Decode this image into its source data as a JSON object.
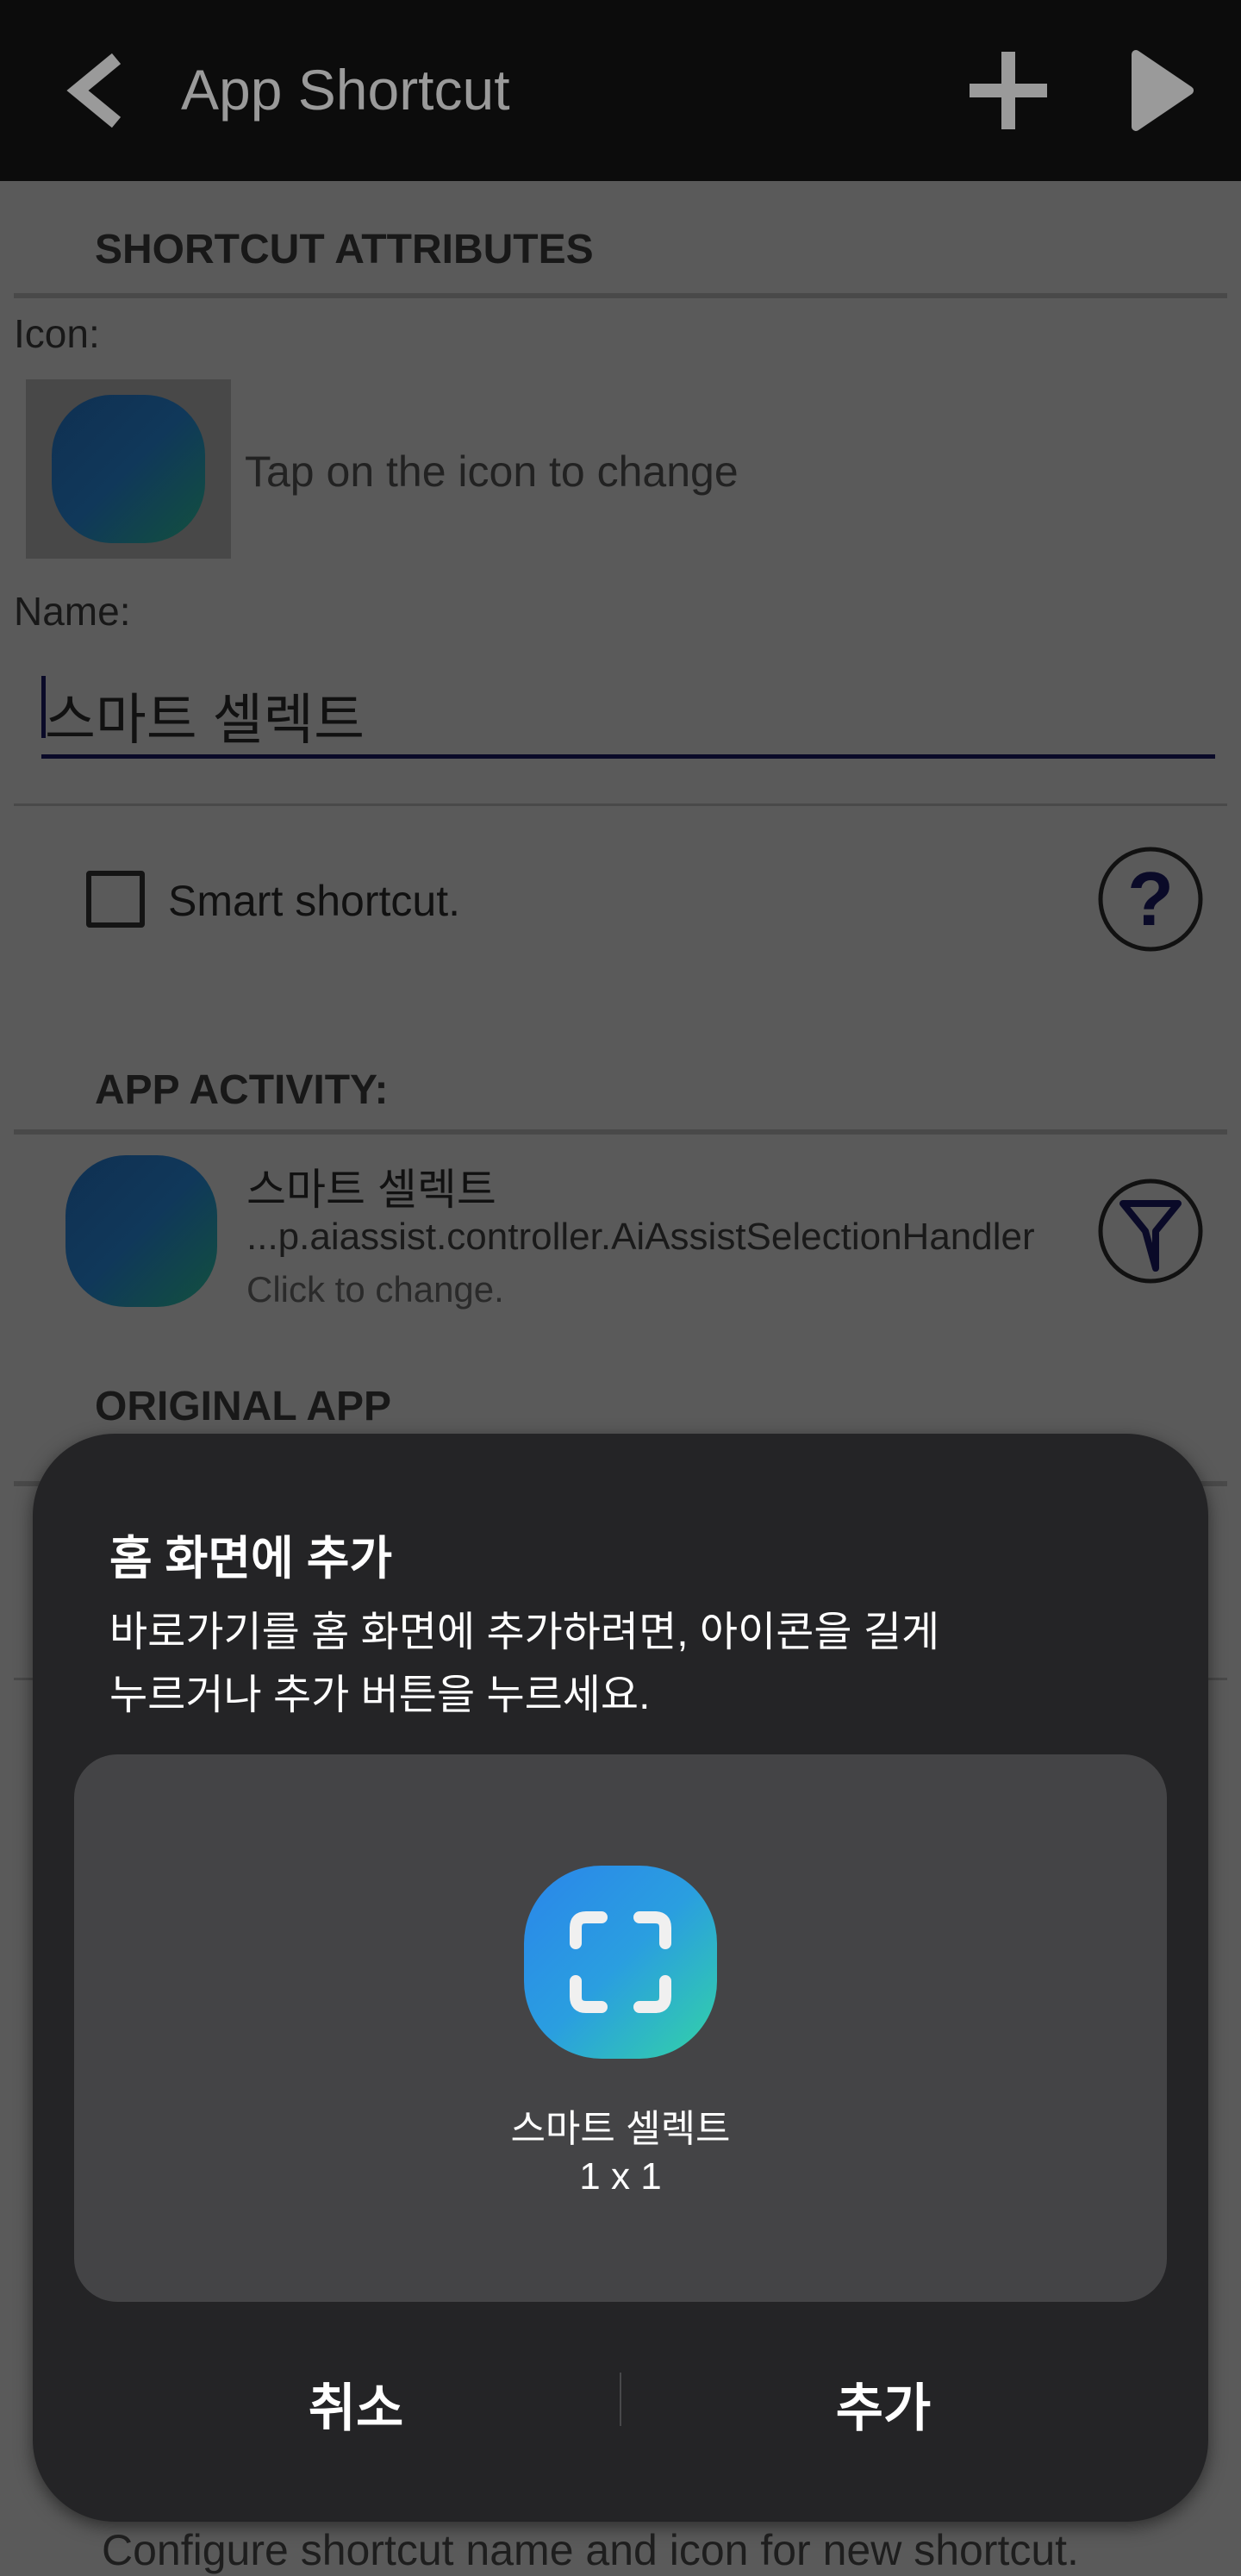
{
  "topbar": {
    "title": "App Shortcut",
    "back_icon": "chevron-left-icon",
    "add_icon": "plus-icon",
    "run_icon": "play-icon"
  },
  "attributes": {
    "section_title": "SHORTCUT ATTRIBUTES",
    "icon_label": "Icon:",
    "icon_hint": "Tap on the icon to change",
    "name_label": "Name:",
    "name_value": "스마트 셀렉트",
    "smart_shortcut_label": "Smart shortcut.",
    "smart_shortcut_checked": false
  },
  "activity": {
    "section_title": "APP ACTIVITY:",
    "app_name": "스마트 셀렉트",
    "class_name": "...p.aiassist.controller.AiAssistSelectionHandler",
    "hint": "Click to change."
  },
  "original": {
    "section_title": "ORIGINAL APP"
  },
  "footer_text": "Configure shortcut name and icon for new shortcut.",
  "dialog": {
    "title": "홈 화면에 추가",
    "message_line1": "바로가기를 홈 화면에 추가하려면, 아이콘을 길게",
    "message_line2": "누르거나 추가 버튼을 누르세요.",
    "preview_name": "스마트 셀렉트",
    "preview_size": "1 x 1",
    "cancel": "취소",
    "add": "추가"
  },
  "colors": {
    "accent": "#1a1a6e",
    "dialog_bg": "#242426",
    "card_bg": "#444446",
    "icon_gradient_start": "#2a86ea",
    "icon_gradient_end": "#33d3a6"
  }
}
